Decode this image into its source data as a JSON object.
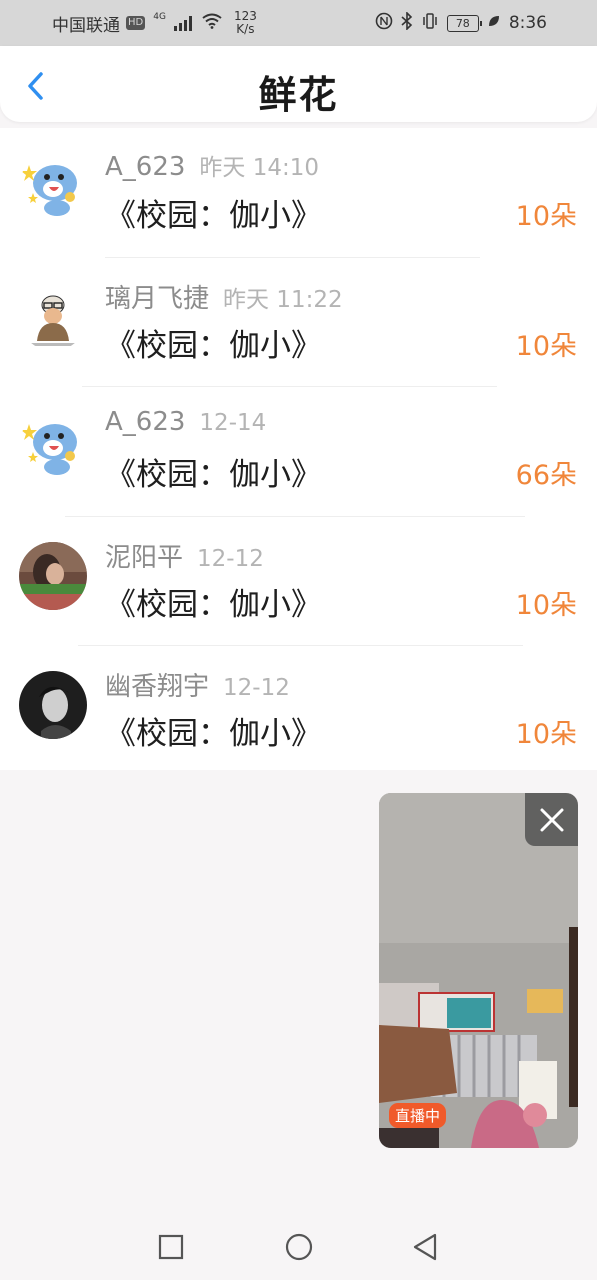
{
  "status_bar": {
    "carrier": "中国联通",
    "hd": "HD",
    "network": "4G",
    "speed_value": "123",
    "speed_unit": "K/s",
    "battery": "78",
    "time": "8:36"
  },
  "header": {
    "title": "鲜花",
    "back_icon": "chevron-left-icon"
  },
  "gifts": [
    {
      "user": "A_623",
      "time": "昨天 14:10",
      "gift": "《校园：伽小》",
      "amount": "10朵",
      "avatar": "cartoon-bird-avatar"
    },
    {
      "user": "璃月飞捷",
      "time": "昨天 11:22",
      "gift": "《校园：伽小》",
      "amount": "10朵",
      "avatar": "meme-man-avatar"
    },
    {
      "user": "A_623",
      "time": "12-14",
      "gift": "《校园：伽小》",
      "amount": "66朵",
      "avatar": "cartoon-bird-avatar"
    },
    {
      "user": "泥阳平",
      "time": "12-12",
      "gift": "《校园：伽小》",
      "amount": "10朵",
      "avatar": "photo-avatar"
    },
    {
      "user": "幽香翔宇",
      "time": "12-12",
      "gift": "《校园：伽小》",
      "amount": "10朵",
      "avatar": "portrait-avatar"
    }
  ],
  "live_window": {
    "badge": "直播中",
    "close_icon": "close-icon"
  },
  "nav_bar": {
    "buttons": [
      "recent-apps-icon",
      "home-icon",
      "back-icon"
    ]
  },
  "colors": {
    "accent_blue": "#2f8ff0",
    "amount_orange": "#f0863a",
    "live_red": "#f05a2a"
  }
}
